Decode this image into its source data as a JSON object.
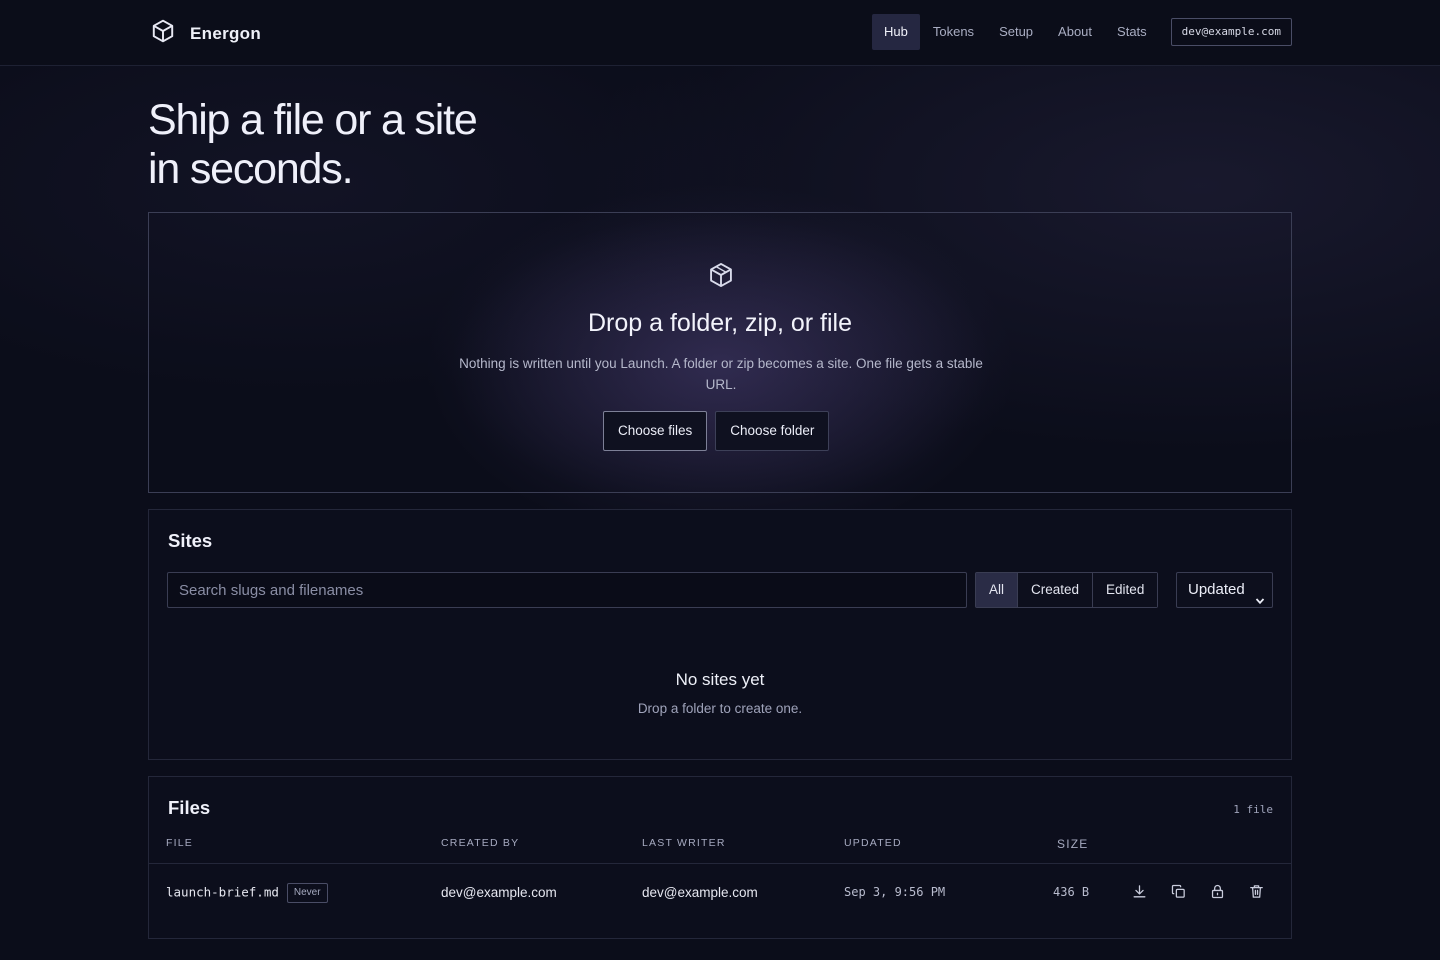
{
  "app": {
    "name": "Energon"
  },
  "nav": {
    "items": [
      {
        "label": "Hub",
        "active": true
      },
      {
        "label": "Tokens"
      },
      {
        "label": "Setup"
      },
      {
        "label": "About"
      },
      {
        "label": "Stats"
      }
    ],
    "user_email": "dev@example.com"
  },
  "hero": {
    "title_line1": "Ship a file or a site",
    "title_line2": "in seconds."
  },
  "dropzone": {
    "icon": "cube-icon",
    "title": "Drop a folder, zip, or file",
    "subtitle": "Nothing is written until you Launch. A folder or zip becomes a site. One file gets a stable URL.",
    "choose_files_label": "Choose files",
    "choose_folder_label": "Choose folder"
  },
  "sites": {
    "title": "Sites",
    "search_placeholder": "Search slugs and filenames",
    "filters": [
      "All",
      "Created",
      "Edited"
    ],
    "active_filter": "All",
    "sort_value": "Updated",
    "empty_title": "No sites yet",
    "empty_subtitle": "Drop a folder to create one."
  },
  "files": {
    "title": "Files",
    "count_label": "1 file",
    "columns": {
      "file": "FILE",
      "created_by": "CREATED BY",
      "last_writer": "LAST WRITER",
      "updated": "UPDATED",
      "size": "SIZE"
    },
    "rows": [
      {
        "name": "launch-brief.md",
        "badge": "Never",
        "created_by": "dev@example.com",
        "last_writer": "dev@example.com",
        "updated": "Sep 3, 9:56 PM",
        "size": "436 B",
        "actions": [
          "download-icon",
          "copy-icon",
          "lock-icon",
          "trash-icon"
        ]
      }
    ]
  },
  "colors": {
    "background": "#0b0d1a",
    "active_nav": "#252741",
    "border": "#3b3e55"
  }
}
